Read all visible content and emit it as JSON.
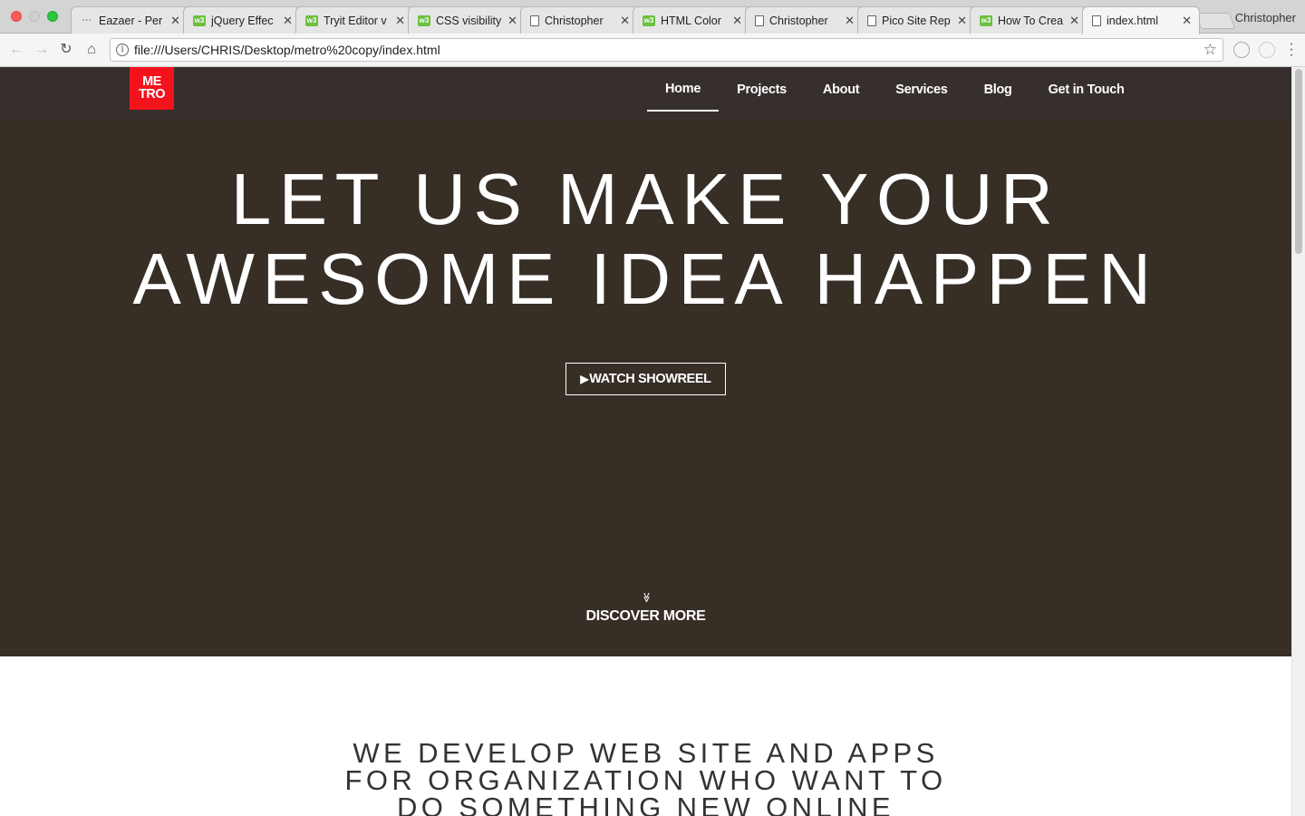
{
  "browser": {
    "tabs": [
      {
        "label": "Eazaer - Per",
        "icon": "ellipsis"
      },
      {
        "label": "jQuery Effec",
        "icon": "w3"
      },
      {
        "label": "Tryit Editor v",
        "icon": "w3"
      },
      {
        "label": "CSS visibility",
        "icon": "w3"
      },
      {
        "label": "Christopher",
        "icon": "doc"
      },
      {
        "label": "HTML Color",
        "icon": "w3"
      },
      {
        "label": "Christopher",
        "icon": "doc"
      },
      {
        "label": "Pico Site Rep",
        "icon": "doc"
      },
      {
        "label": "How To Crea",
        "icon": "w3"
      },
      {
        "label": "index.html",
        "icon": "doc",
        "active": true
      }
    ],
    "profile": "Christopher",
    "url": "file:///Users/CHRIS/Desktop/metro%20copy/index.html"
  },
  "site": {
    "logo": {
      "line1": "ME",
      "line2": "TRO",
      "color": "#f3131d"
    },
    "nav": [
      {
        "label": "Home",
        "active": true
      },
      {
        "label": "Projects"
      },
      {
        "label": "About"
      },
      {
        "label": "Services"
      },
      {
        "label": "Blog"
      },
      {
        "label": "Get in Touch"
      }
    ],
    "hero": {
      "line1": "LET US MAKE YOUR",
      "line2": "AWESOME IDEA HAPPEN",
      "play_glyph": "▶",
      "button_label": "WATCH SHOWREEL",
      "discover_chevron": "≫",
      "discover_label": "DISCOVER MORE",
      "background": "#372e26"
    },
    "intro": {
      "line1": "WE DEVELOP WEB SITE AND APPS",
      "line2": "FOR ORGANIZATION WHO WANT TO",
      "line3": "DO SOMETHING NEW ONLINE"
    },
    "header_background": "#362f2e"
  }
}
